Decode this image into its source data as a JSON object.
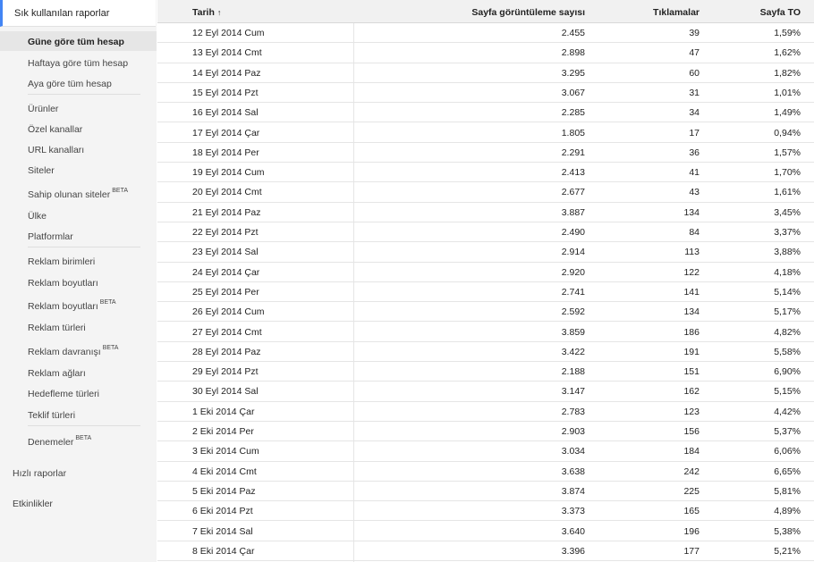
{
  "sidebar": {
    "header": "Sık kullanılan raporlar",
    "group1": [
      {
        "label": "Güne göre tüm hesap",
        "active": true
      },
      {
        "label": "Haftaya göre tüm hesap"
      },
      {
        "label": "Aya göre tüm hesap"
      }
    ],
    "group2": [
      {
        "label": "Ürünler"
      },
      {
        "label": "Özel kanallar"
      },
      {
        "label": "URL kanalları"
      },
      {
        "label": "Siteler"
      },
      {
        "label": "Sahip olunan siteler",
        "beta": "BETA"
      },
      {
        "label": "Ülke"
      },
      {
        "label": "Platformlar"
      }
    ],
    "group3": [
      {
        "label": "Reklam birimleri"
      },
      {
        "label": "Reklam boyutları"
      },
      {
        "label": "Reklam boyutları",
        "beta": "BETA"
      },
      {
        "label": "Reklam türleri"
      },
      {
        "label": "Reklam davranışı",
        "beta": "BETA"
      },
      {
        "label": "Reklam ağları"
      },
      {
        "label": "Hedefleme türleri"
      },
      {
        "label": "Teklif türleri"
      }
    ],
    "group4": [
      {
        "label": "Denemeler",
        "beta": "BETA"
      }
    ],
    "quick_reports": "Hızlı raporlar",
    "events": "Etkinlikler"
  },
  "table": {
    "headers": {
      "date": "Tarih",
      "sort_icon": "↑",
      "pageviews": "Sayfa görüntüleme sayısı",
      "clicks": "Tıklamalar",
      "ctr": "Sayfa TO"
    },
    "rows": [
      {
        "date": "12 Eyl 2014 Cum",
        "pageviews": "2.455",
        "clicks": "39",
        "ctr": "1,59%"
      },
      {
        "date": "13 Eyl 2014 Cmt",
        "pageviews": "2.898",
        "clicks": "47",
        "ctr": "1,62%"
      },
      {
        "date": "14 Eyl 2014 Paz",
        "pageviews": "3.295",
        "clicks": "60",
        "ctr": "1,82%"
      },
      {
        "date": "15 Eyl 2014 Pzt",
        "pageviews": "3.067",
        "clicks": "31",
        "ctr": "1,01%"
      },
      {
        "date": "16 Eyl 2014 Sal",
        "pageviews": "2.285",
        "clicks": "34",
        "ctr": "1,49%"
      },
      {
        "date": "17 Eyl 2014 Çar",
        "pageviews": "1.805",
        "clicks": "17",
        "ctr": "0,94%"
      },
      {
        "date": "18 Eyl 2014 Per",
        "pageviews": "2.291",
        "clicks": "36",
        "ctr": "1,57%"
      },
      {
        "date": "19 Eyl 2014 Cum",
        "pageviews": "2.413",
        "clicks": "41",
        "ctr": "1,70%"
      },
      {
        "date": "20 Eyl 2014 Cmt",
        "pageviews": "2.677",
        "clicks": "43",
        "ctr": "1,61%"
      },
      {
        "date": "21 Eyl 2014 Paz",
        "pageviews": "3.887",
        "clicks": "134",
        "ctr": "3,45%"
      },
      {
        "date": "22 Eyl 2014 Pzt",
        "pageviews": "2.490",
        "clicks": "84",
        "ctr": "3,37%"
      },
      {
        "date": "23 Eyl 2014 Sal",
        "pageviews": "2.914",
        "clicks": "113",
        "ctr": "3,88%"
      },
      {
        "date": "24 Eyl 2014 Çar",
        "pageviews": "2.920",
        "clicks": "122",
        "ctr": "4,18%"
      },
      {
        "date": "25 Eyl 2014 Per",
        "pageviews": "2.741",
        "clicks": "141",
        "ctr": "5,14%"
      },
      {
        "date": "26 Eyl 2014 Cum",
        "pageviews": "2.592",
        "clicks": "134",
        "ctr": "5,17%"
      },
      {
        "date": "27 Eyl 2014 Cmt",
        "pageviews": "3.859",
        "clicks": "186",
        "ctr": "4,82%"
      },
      {
        "date": "28 Eyl 2014 Paz",
        "pageviews": "3.422",
        "clicks": "191",
        "ctr": "5,58%"
      },
      {
        "date": "29 Eyl 2014 Pzt",
        "pageviews": "2.188",
        "clicks": "151",
        "ctr": "6,90%"
      },
      {
        "date": "30 Eyl 2014 Sal",
        "pageviews": "3.147",
        "clicks": "162",
        "ctr": "5,15%"
      },
      {
        "date": "1 Eki 2014 Çar",
        "pageviews": "2.783",
        "clicks": "123",
        "ctr": "4,42%"
      },
      {
        "date": "2 Eki 2014 Per",
        "pageviews": "2.903",
        "clicks": "156",
        "ctr": "5,37%"
      },
      {
        "date": "3 Eki 2014 Cum",
        "pageviews": "3.034",
        "clicks": "184",
        "ctr": "6,06%"
      },
      {
        "date": "4 Eki 2014 Cmt",
        "pageviews": "3.638",
        "clicks": "242",
        "ctr": "6,65%"
      },
      {
        "date": "5 Eki 2014 Paz",
        "pageviews": "3.874",
        "clicks": "225",
        "ctr": "5,81%"
      },
      {
        "date": "6 Eki 2014 Pzt",
        "pageviews": "3.373",
        "clicks": "165",
        "ctr": "4,89%"
      },
      {
        "date": "7 Eki 2014 Sal",
        "pageviews": "3.640",
        "clicks": "196",
        "ctr": "5,38%"
      },
      {
        "date": "8 Eki 2014 Çar",
        "pageviews": "3.396",
        "clicks": "177",
        "ctr": "5,21%"
      }
    ]
  }
}
